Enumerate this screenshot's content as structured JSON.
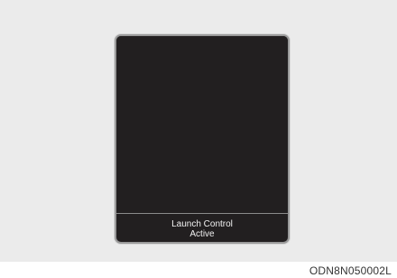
{
  "cluster": {
    "message_line1": "Launch Control",
    "message_line2": "Active"
  },
  "figure": {
    "code": "ODN8N050002L"
  }
}
